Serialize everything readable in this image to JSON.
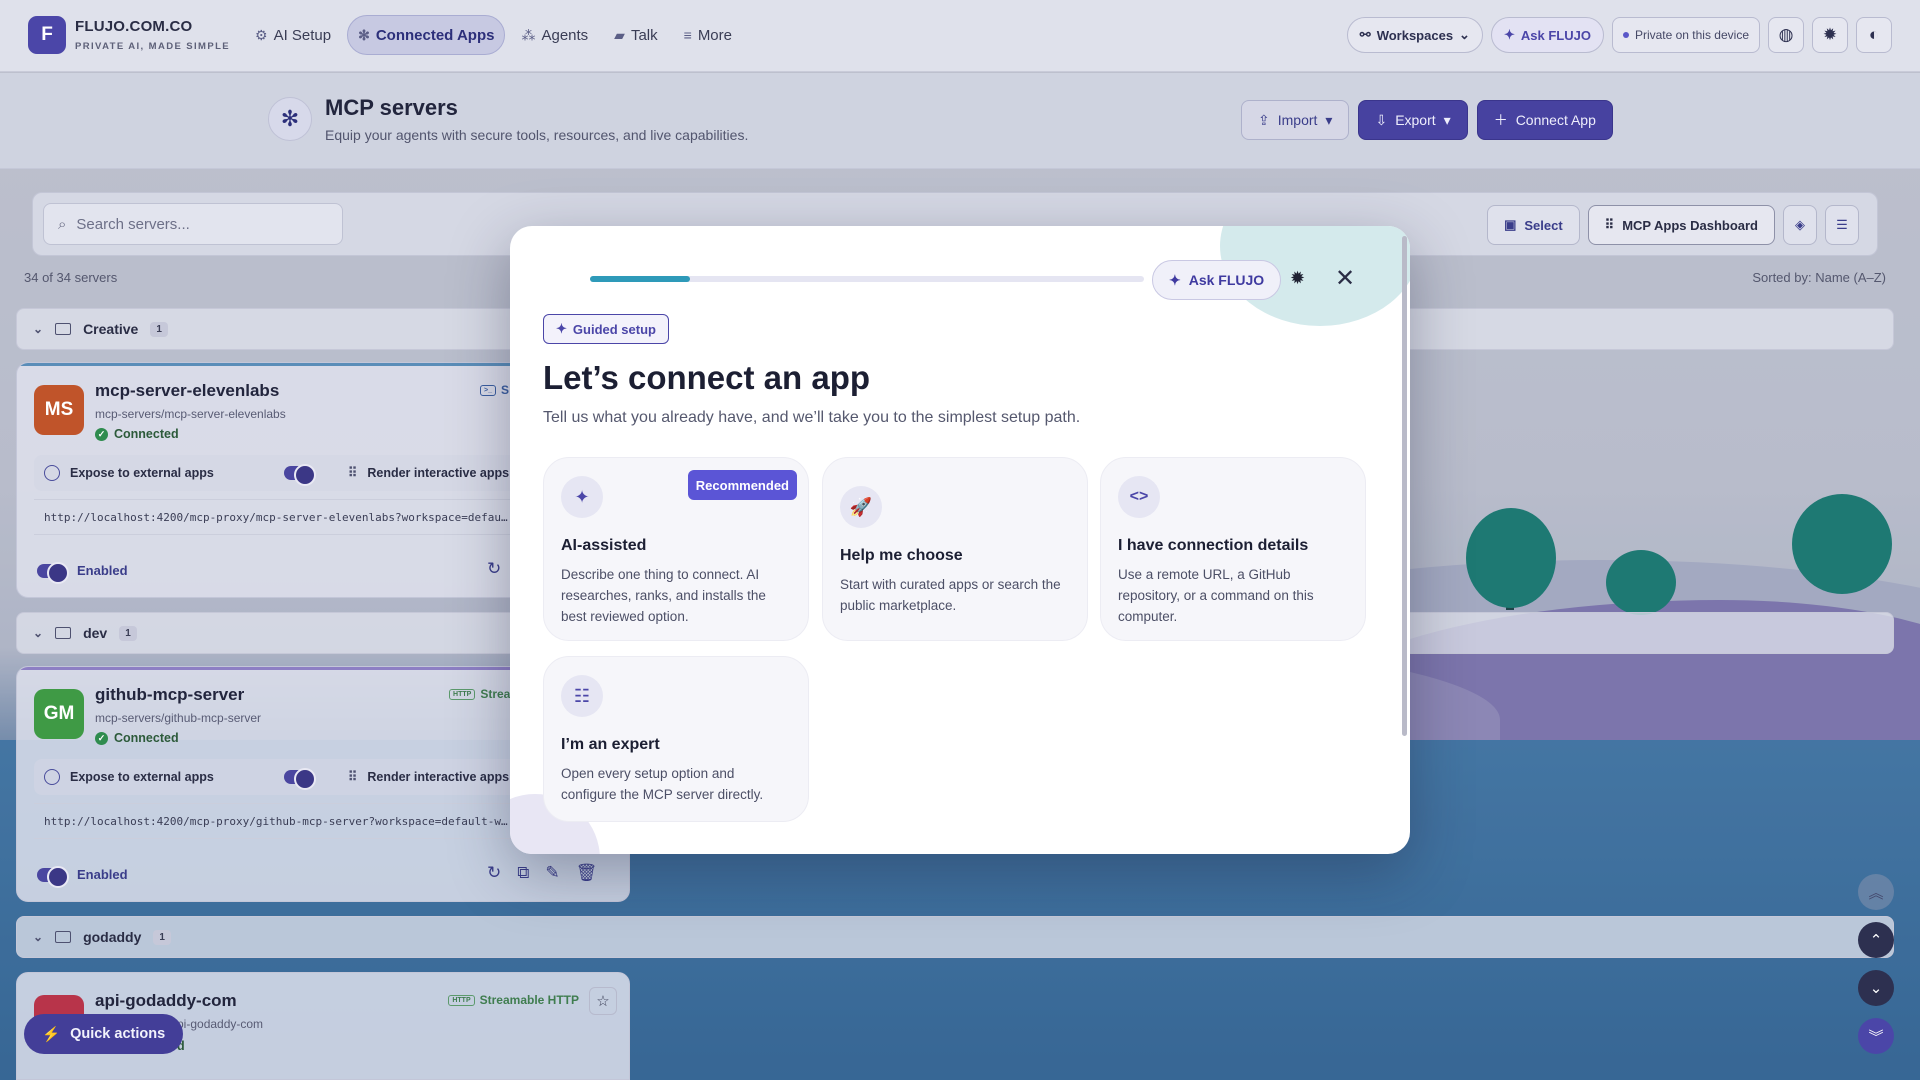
{
  "brand": {
    "logo": "F",
    "name": "FLUJO.COM.CO",
    "tagline": "PRIVATE AI, MADE SIMPLE"
  },
  "nav": [
    {
      "label": "AI Setup",
      "icon": "gear-icon",
      "active": false
    },
    {
      "label": "Connected Apps",
      "icon": "network-icon",
      "active": true
    },
    {
      "label": "Agents",
      "icon": "agents-icon",
      "active": false
    },
    {
      "label": "Talk",
      "icon": "chat-icon",
      "active": false
    },
    {
      "label": "More",
      "icon": "menu-icon",
      "active": false
    }
  ],
  "topbar": {
    "workspaces": "Workspaces",
    "ask": "Ask FLUJO",
    "private": "Private on this device"
  },
  "header": {
    "title": "MCP servers",
    "subtitle": "Equip your agents with secure tools, resources, and live capabilities.",
    "import": "Import",
    "export": "Export",
    "connect": "Connect App"
  },
  "toolbar": {
    "search_placeholder": "Search servers...",
    "select": "Select",
    "dashboard": "MCP Apps Dashboard",
    "count": "34 of 34 servers",
    "sorted": "Sorted by: Name (A–Z)"
  },
  "groups": [
    {
      "name": "Creative",
      "count": "1"
    },
    {
      "name": "dev",
      "count": "1"
    },
    {
      "name": "godaddy",
      "count": "1"
    }
  ],
  "servers": [
    {
      "initials": "MS",
      "name": "mcp-server-elevenlabs",
      "path": "mcp-servers/mcp-server-elevenlabs",
      "status": "Connected",
      "transport": "S",
      "expose": "Expose to external apps",
      "render": "Render interactive apps",
      "url": "http://localhost:4200/mcp-proxy/mcp-server-elevenlabs?workspace=defau…",
      "enabled": "Enabled",
      "color": "#c0542a"
    },
    {
      "initials": "GM",
      "name": "github-mcp-server",
      "path": "mcp-servers/github-mcp-server",
      "status": "Connected",
      "transport": "Stream",
      "expose": "Expose to external apps",
      "render": "Render interactive apps",
      "url": "http://localhost:4200/mcp-proxy/github-mcp-server?workspace=default-w…",
      "enabled": "Enabled",
      "color": "#3f9a45"
    },
    {
      "name": "api-godaddy-com",
      "path": "/api-godaddy-com",
      "status": "d",
      "transport": "Streamable HTTP",
      "color": "#b8344a"
    }
  ],
  "transport_tag": "HTTP",
  "quick_actions": "Quick actions",
  "modal": {
    "progress_percent": 18,
    "ask": "Ask FLUJO",
    "badge": "Guided setup",
    "title": "Let’s connect an app",
    "subtitle": "Tell us what you already have, and we’ll take you to the simplest setup path.",
    "options": [
      {
        "title": "AI-assisted",
        "desc": "Describe one thing to connect. AI researches, ranks, and installs the best reviewed option.",
        "badge": "Recommended",
        "icon": "sparkles-icon"
      },
      {
        "title": "Help me choose",
        "desc": "Start with curated apps or search the public marketplace.",
        "icon": "rocket-icon"
      },
      {
        "title": "I have connection details",
        "desc": "Use a remote URL, a GitHub repository, or a command on this computer.",
        "icon": "code-icon"
      },
      {
        "title": "I’m an expert",
        "desc": "Open every setup option and configure the MCP server directly.",
        "icon": "sliders-icon"
      }
    ]
  },
  "colors": {
    "accent": "#4b46a8",
    "progress": "#2e9ab9",
    "recommended": "#5b55d6",
    "connected": "#2f8c4f"
  }
}
